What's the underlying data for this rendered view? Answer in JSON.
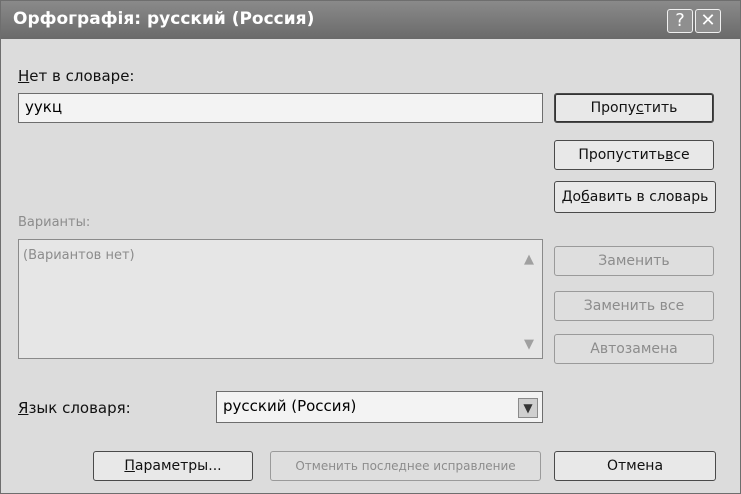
{
  "window": {
    "title": "Орфографія: русский (Россия)"
  },
  "not_in_dictionary": {
    "label_accel": "Н",
    "label_rest": "ет в словаре:",
    "value": "уукц"
  },
  "suggestions": {
    "label": "Варианты:",
    "empty_text": "(Вариантов нет)"
  },
  "buttons": {
    "skip": {
      "pre": "Пропу",
      "accel": "с",
      "post": "тить"
    },
    "skip_all": {
      "pre": "Пропустить ",
      "accel": "в",
      "post": "се"
    },
    "add": {
      "pre": "До",
      "accel": "б",
      "post": "авить в словарь"
    },
    "replace": "Заменить",
    "replace_all": "Заменить все",
    "autocorrect": "Автозамена",
    "options": {
      "accel": "П",
      "post": "араметры..."
    },
    "undo": "Отменить последнее исправление",
    "cancel": "Отмена"
  },
  "language": {
    "label_accel": "Я",
    "label_rest": "зык словаря:",
    "value": "русский (Россия)"
  }
}
